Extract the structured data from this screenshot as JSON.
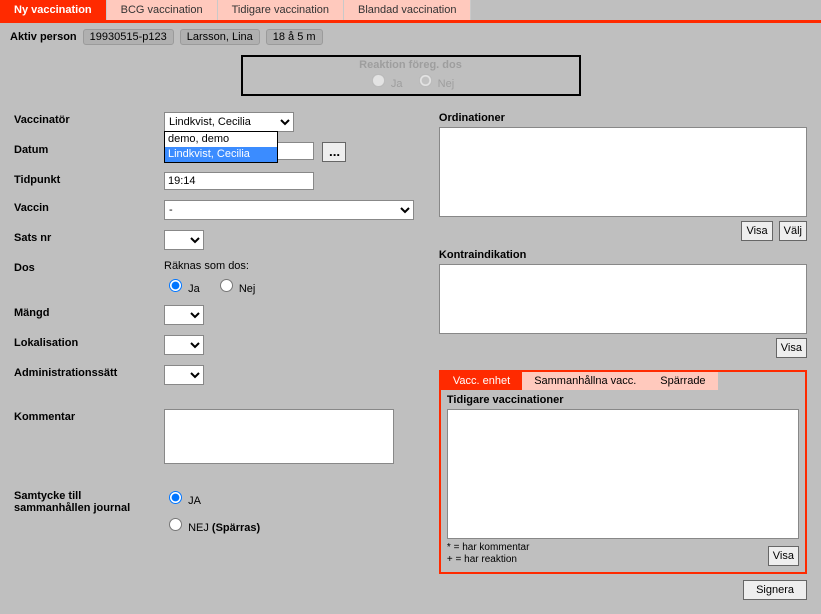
{
  "tabs": {
    "items": [
      "Ny vaccination",
      "BCG vaccination",
      "Tidigare vaccination",
      "Blandad vaccination"
    ],
    "active_index": 0
  },
  "person": {
    "label": "Aktiv person",
    "id": "19930515-p123",
    "name": "Larsson, Lina",
    "age": "18 å 5 m"
  },
  "reaction_box": {
    "title": "Reaktion föreg. dos",
    "yes": "Ja",
    "no": "Nej",
    "checked": "no"
  },
  "form": {
    "vaccinator": {
      "label": "Vaccinatör",
      "selected": "Lindkvist, Cecilia",
      "options": [
        "demo, demo",
        "Lindkvist, Cecilia"
      ],
      "open_highlight_index": 1
    },
    "datum": {
      "label": "Datum",
      "value": ""
    },
    "tidpunkt": {
      "label": "Tidpunkt",
      "value": "19:14"
    },
    "vaccin": {
      "label": "Vaccin",
      "value": "-"
    },
    "sats": {
      "label": "Sats nr",
      "value": ""
    },
    "dos": {
      "label": "Dos",
      "group_label": "Räknas som dos:",
      "yes": "Ja",
      "no": "Nej",
      "checked": "yes"
    },
    "mangd": {
      "label": "Mängd",
      "value": ""
    },
    "lokalisation": {
      "label": "Lokalisation",
      "value": ""
    },
    "admin": {
      "label": "Administrationssätt",
      "value": ""
    },
    "kommentar": {
      "label": "Kommentar",
      "value": ""
    },
    "samtycke": {
      "label_line1": "Samtycke till",
      "label_line2": "sammanhållen journal",
      "yes": "JA",
      "no_label": "NEJ",
      "no_suffix": "(Spärras)",
      "checked": "yes"
    }
  },
  "right": {
    "ord_title": "Ordinationer",
    "visa": "Visa",
    "valj": "Välj",
    "kontra_title": "Kontraindikation",
    "kontra_visa": "Visa"
  },
  "prev": {
    "tabs": [
      "Vacc. enhet",
      "Sammanhållna vacc.",
      "Spärrade"
    ],
    "active_index": 0,
    "title": "Tidigare vaccinationer",
    "legend1": "* = har kommentar",
    "legend2": "+ = har reaktion",
    "visa": "Visa"
  },
  "signera": "Signera"
}
